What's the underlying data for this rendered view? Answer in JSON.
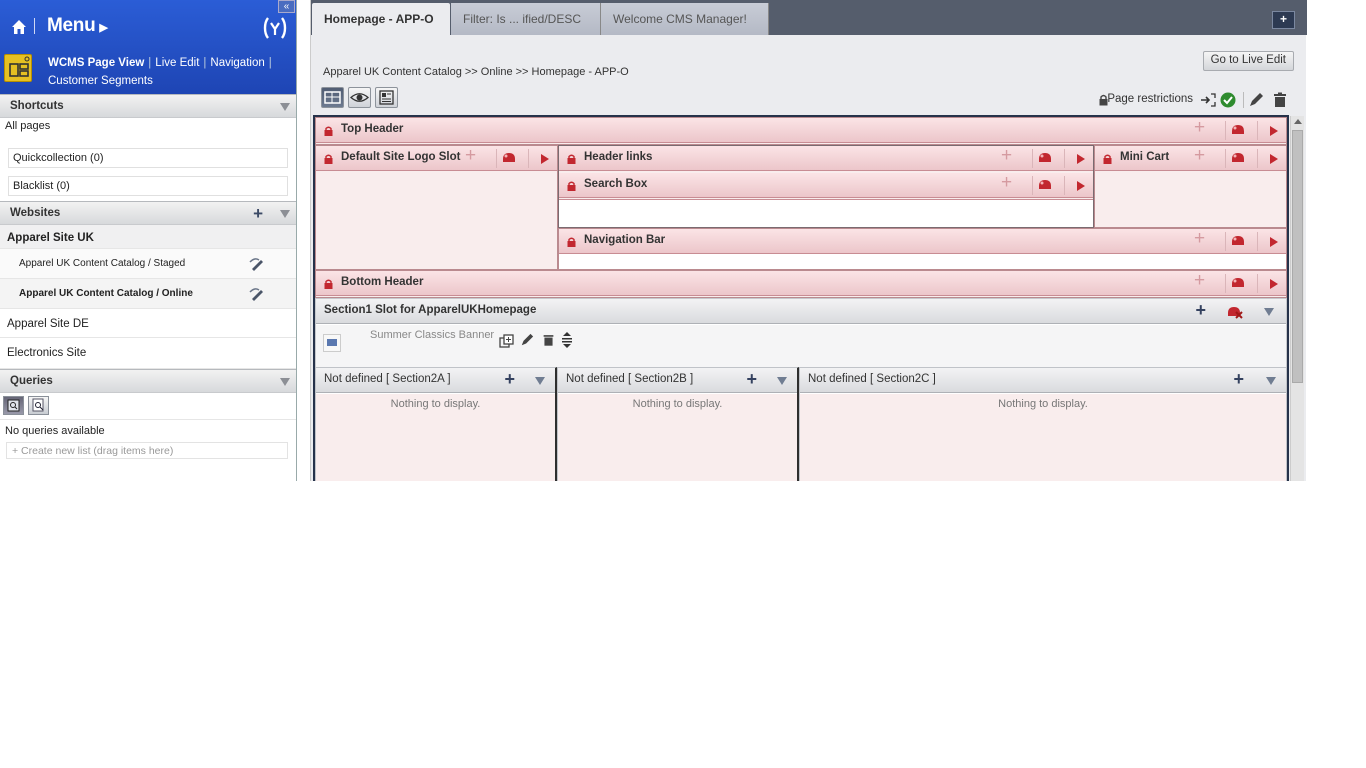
{
  "sidebar": {
    "menu_title": "Menu",
    "nav_links": [
      "WCMS Page View",
      "Live Edit",
      "Navigation",
      "Customer Segments"
    ],
    "shortcuts": {
      "heading": "Shortcuts",
      "all_pages": "All pages",
      "quickcollection": "Quickcollection (0)",
      "blacklist": "Blacklist (0)"
    },
    "websites": {
      "heading": "Websites",
      "sites": [
        {
          "label": "Apparel Site UK"
        },
        {
          "label": "Apparel Site DE"
        },
        {
          "label": "Electronics Site"
        }
      ],
      "catalogs": [
        {
          "label": "Apparel UK Content Catalog / Staged"
        },
        {
          "label": "Apparel UK Content Catalog / Online"
        }
      ]
    },
    "queries": {
      "heading": "Queries",
      "empty_text": "No queries available",
      "new_list_placeholder": "+ Create new list (drag items here)"
    }
  },
  "tabs": [
    {
      "label": "Homepage - APP-O",
      "active": true
    },
    {
      "label": "Filter: Is ... ified/DESC",
      "active": false
    },
    {
      "label": "Welcome CMS Manager!",
      "active": false
    }
  ],
  "toolbar": {
    "go_live_edit": "Go to Live Edit",
    "breadcrumb": "Apparel UK Content Catalog >> Online >> Homepage - APP-O",
    "page_restrictions": "Page restrictions"
  },
  "slots": {
    "top_header": "Top Header",
    "default_logo": "Default Site Logo Slot",
    "header_links": "Header links",
    "search_box": "Search Box",
    "mini_cart": "Mini Cart",
    "navigation_bar": "Navigation Bar",
    "bottom_header": "Bottom Header",
    "section1": "Section1 Slot for ApparelUKHomepage",
    "summer_banner": "Summer Classics Banner",
    "section2a": "Not defined [ Section2A ]",
    "section2b": "Not defined [ Section2B ]",
    "section2c": "Not defined [ Section2C ]",
    "nothing_to_display": "Nothing to display."
  },
  "colors": {
    "menu_blue": "#2550c8",
    "tab_bar": "#555d6c",
    "slot_pink": "#f9eded",
    "lock_red": "#c2272f"
  },
  "icons": [
    "home-icon",
    "hybris-logo-icon",
    "wcms-app-icon",
    "edit-icon",
    "search-query-icon",
    "lock-icon",
    "add-icon",
    "remove-icon",
    "play-icon",
    "eye-icon",
    "approve-icon",
    "delete-icon"
  ]
}
